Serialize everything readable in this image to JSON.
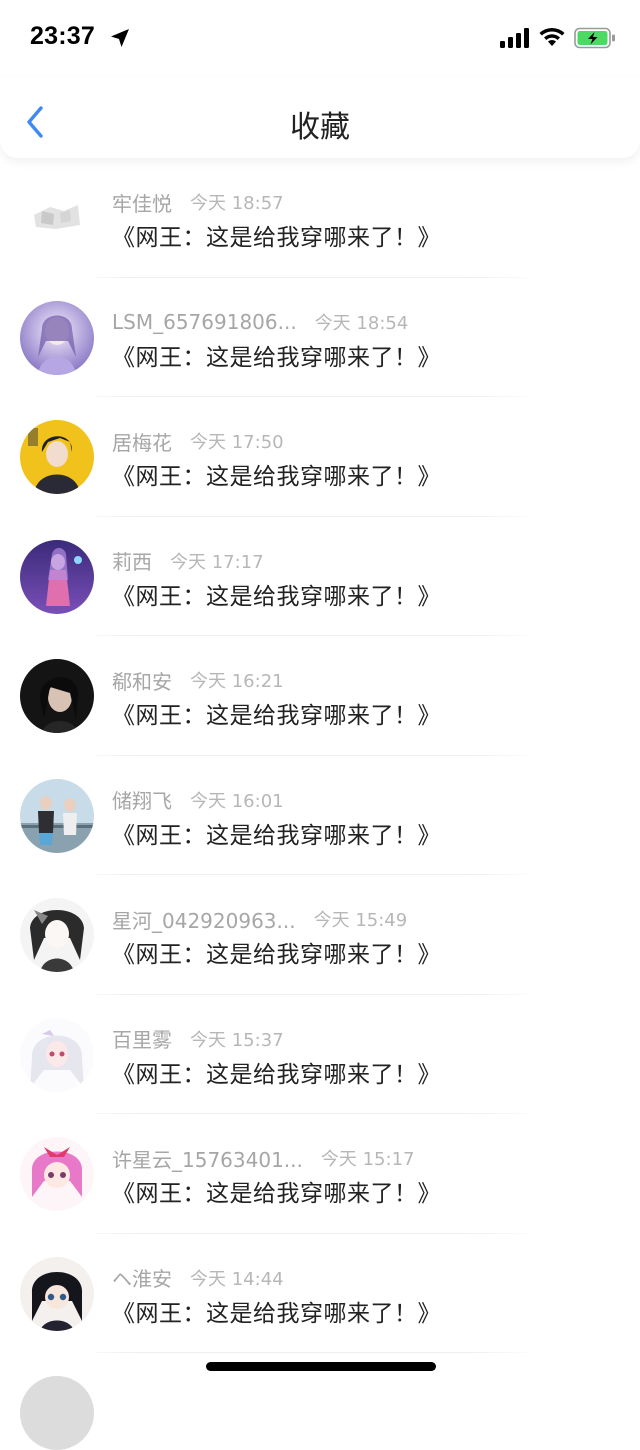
{
  "status_bar": {
    "time": "23:37",
    "icons": [
      "location-arrow-icon",
      "cellular-signal-icon",
      "wifi-icon",
      "battery-charging-icon"
    ],
    "battery_color": "#4cd964"
  },
  "header": {
    "title": "收藏",
    "back_icon": "chevron-left-icon",
    "accent_color": "#3d8bf2"
  },
  "items": [
    {
      "username": "牢佳悦",
      "time": "今天 18:57",
      "title": "《网王：这是给我穿哪来了！》",
      "avatar": "placeholder-avatar"
    },
    {
      "username": "LSM_657691806...",
      "time": "今天 18:54",
      "title": "《网王：这是给我穿哪来了！》",
      "avatar": "anime-girl-purple-avatar"
    },
    {
      "username": "居梅花",
      "time": "今天 17:50",
      "title": "《网王：这是给我穿哪来了！》",
      "avatar": "anime-boy-yellow-avatar"
    },
    {
      "username": "莉西",
      "time": "今天 17:17",
      "title": "《网王：这是给我穿哪来了！》",
      "avatar": "anime-purple-figure-avatar"
    },
    {
      "username": "郗和安",
      "time": "今天 16:21",
      "title": "《网王：这是给我穿哪来了！》",
      "avatar": "dark-hair-man-avatar"
    },
    {
      "username": "储翔飞",
      "time": "今天 16:01",
      "title": "《网王：这是给我穿哪来了！》",
      "avatar": "two-people-photo-avatar"
    },
    {
      "username": "星河_042920963...",
      "time": "今天 15:49",
      "title": "《网王：这是给我穿哪来了！》",
      "avatar": "anime-monochrome-avatar"
    },
    {
      "username": "百里雾",
      "time": "今天 15:37",
      "title": "《网王：这是给我穿哪来了！》",
      "avatar": "anime-white-hair-girl-avatar"
    },
    {
      "username": "许星云_15763401...",
      "time": "今天 15:17",
      "title": "《网王：这是给我穿哪来了！》",
      "avatar": "anime-pink-hair-girl-avatar"
    },
    {
      "username": "ヘ淮安",
      "time": "今天 14:44",
      "title": "《网王：这是给我穿哪来了！》",
      "avatar": "anime-dark-hair-boy-avatar"
    }
  ]
}
